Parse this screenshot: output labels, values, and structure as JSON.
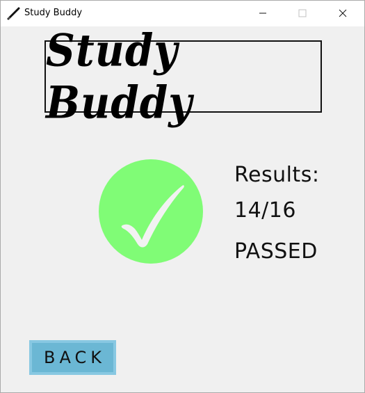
{
  "window": {
    "title": "Study Buddy",
    "app_icon": "pencil-icon"
  },
  "titlebar_buttons": {
    "minimize_icon": "minimize-icon",
    "maximize_icon": "maximize-icon",
    "close_icon": "close-icon"
  },
  "logo": {
    "text": "Study Buddy"
  },
  "result": {
    "icon": "checkmark-icon",
    "icon_bg_color": "#80fc76",
    "label": "Results:",
    "score": "14/16",
    "status": "PASSED"
  },
  "back_button": {
    "label": "BACK",
    "color": "#6bb7d4"
  }
}
